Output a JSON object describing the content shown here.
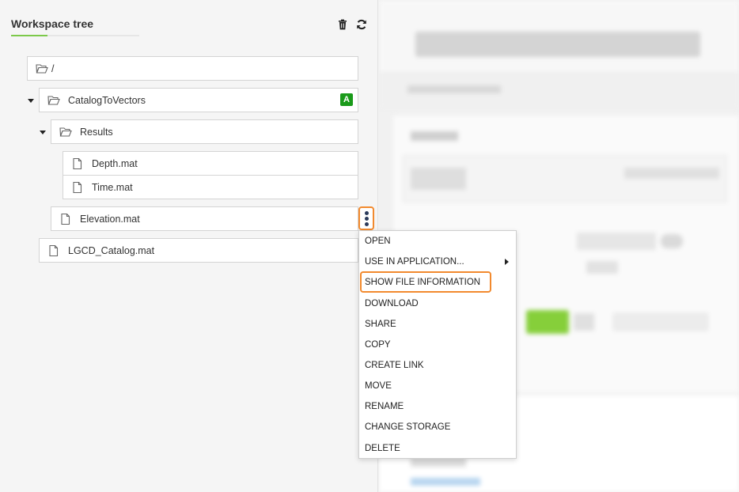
{
  "panel": {
    "title": "Workspace tree",
    "actions": [
      "trash-icon",
      "refresh-icon"
    ]
  },
  "tree": {
    "root": {
      "label": "/",
      "icon": "folder-open-icon"
    },
    "catalog": {
      "label": "CatalogToVectors",
      "icon": "folder-open-icon",
      "badge": "A",
      "expanded": true
    },
    "results": {
      "label": "Results",
      "icon": "folder-open-icon",
      "expanded": true
    },
    "depth": {
      "label": "Depth.mat",
      "icon": "file-icon"
    },
    "time": {
      "label": "Time.mat",
      "icon": "file-icon"
    },
    "elevation": {
      "label": "Elevation.mat",
      "icon": "file-icon"
    },
    "lgcd": {
      "label": "LGCD_Catalog.mat",
      "icon": "file-icon"
    }
  },
  "context_menu": {
    "items": [
      "OPEN",
      "USE IN APPLICATION...",
      "SHOW FILE INFORMATION",
      "DOWNLOAD",
      "SHARE",
      "COPY",
      "CREATE LINK",
      "MOVE",
      "RENAME",
      "CHANGE STORAGE",
      "DELETE"
    ],
    "highlighted": "SHOW FILE INFORMATION"
  },
  "colors": {
    "accent": "#7cc94a",
    "badge": "#1a9a1a",
    "highlight": "#f28a2e"
  }
}
